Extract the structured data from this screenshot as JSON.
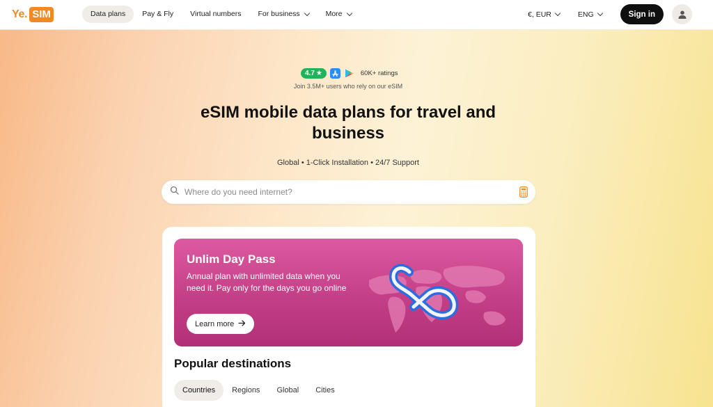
{
  "header": {
    "logo_ye": "Ye.",
    "logo_sim": "SIM",
    "nav": [
      {
        "label": "Data plans",
        "active": true,
        "dropdown": false
      },
      {
        "label": "Pay & Fly",
        "active": false,
        "dropdown": false
      },
      {
        "label": "Virtual numbers",
        "active": false,
        "dropdown": false
      },
      {
        "label": "For business",
        "active": false,
        "dropdown": true
      },
      {
        "label": "More",
        "active": false,
        "dropdown": true
      }
    ],
    "currency": "€, EUR",
    "language": "ENG",
    "signin_label": "Sign in",
    "avatar_icon": "user-icon"
  },
  "hero": {
    "rating": "4.7",
    "rating_icon": "star-icon",
    "store_icons": [
      "app-store-icon",
      "google-play-icon"
    ],
    "ratings_count": "60K+ ratings",
    "join_text": "Join 3.5M+ users who rely on our eSIM",
    "title": "eSIM mobile data plans for travel and business",
    "features": "Global • 1-Click Installation • 24/7 Support"
  },
  "search": {
    "placeholder": "Where do you need internet?",
    "icon": "search-icon",
    "right_icon": "calculator-icon"
  },
  "promo": {
    "title": "Unlim Day Pass",
    "description": "Annual plan with unlimited data when you need it. Pay only for the days you go online",
    "button_label": "Learn more",
    "button_icon": "arrow-right-icon",
    "colors": {
      "gradient_top": "#dc5aa0",
      "gradient_bottom": "#b13176"
    }
  },
  "destinations": {
    "title": "Popular destinations",
    "tabs": [
      {
        "label": "Countries",
        "active": true
      },
      {
        "label": "Regions",
        "active": false
      },
      {
        "label": "Global",
        "active": false
      },
      {
        "label": "Cities",
        "active": false
      }
    ]
  },
  "colors": {
    "brand": "#f08a24",
    "rating_green": "#22b35a",
    "button_dark": "#0f0f0f"
  }
}
